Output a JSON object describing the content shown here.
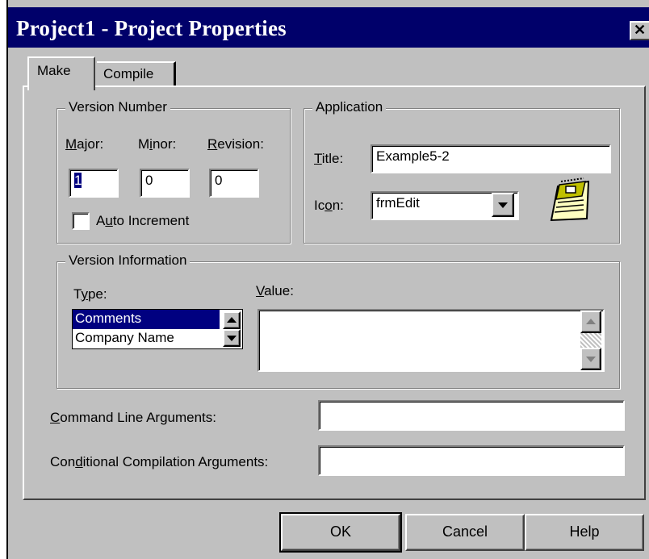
{
  "window": {
    "title": "Project1 - Project Properties",
    "close_glyph": "✕"
  },
  "tabs": [
    {
      "label": "Make",
      "selected": true
    },
    {
      "label": "Compile",
      "selected": false
    }
  ],
  "version_number": {
    "legend": "Version Number",
    "major": {
      "label_u": "M",
      "label_rest": "ajor:",
      "value": "1"
    },
    "minor": {
      "label_pre": "M",
      "label_u": "i",
      "label_rest": "nor:",
      "value": "0"
    },
    "revision": {
      "label_u": "R",
      "label_rest": "evision:",
      "value": "0"
    },
    "auto_increment": {
      "label_pre": "A",
      "label_u": "u",
      "label_rest": "to Increment",
      "checked": false
    }
  },
  "application": {
    "legend": "Application",
    "title": {
      "label_u": "T",
      "label_rest": "itle:",
      "value": "Example5-2"
    },
    "icon": {
      "label_pre": "Ic",
      "label_u": "o",
      "label_rest": "n:",
      "value": "frmEdit",
      "image": "notepad-icon"
    }
  },
  "version_information": {
    "legend": "Version Information",
    "type": {
      "label_pre": "T",
      "label_u": "y",
      "label_rest": "pe:",
      "items": [
        "Comments",
        "Company Name"
      ],
      "selected_index": 0
    },
    "value": {
      "label_u": "V",
      "label_rest": "alue:",
      "text": ""
    }
  },
  "command_line": {
    "label_u": "C",
    "label_rest": "ommand Line Arguments:",
    "value": ""
  },
  "conditional": {
    "label_pre": "Con",
    "label_u": "d",
    "label_rest": "itional Compilation Arguments:",
    "value": ""
  },
  "buttons": {
    "ok": "OK",
    "cancel": "Cancel",
    "help": "Help"
  },
  "colors": {
    "title_bar": "#00006a",
    "face": "#c0c0c0",
    "selection": "#000080"
  }
}
